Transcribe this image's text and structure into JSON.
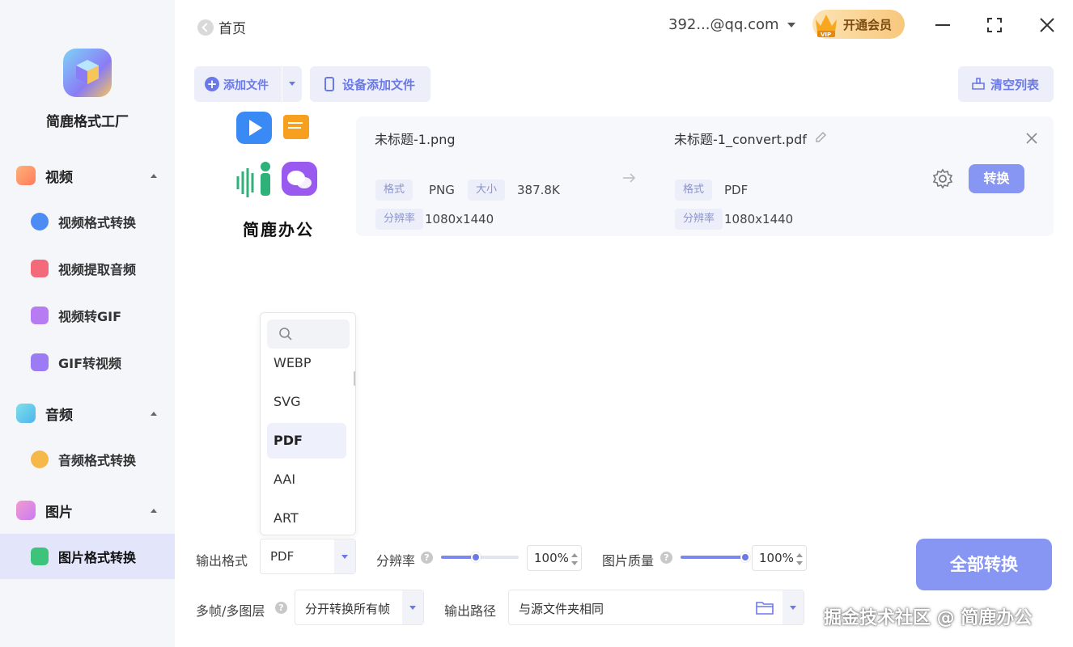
{
  "sidebar": {
    "app_name": "简鹿格式工厂",
    "groups": [
      {
        "label": "视频",
        "items": [
          "视频格式转换",
          "视频提取音频",
          "视频转GIF",
          "GIF转视频"
        ]
      },
      {
        "label": "音频",
        "items": [
          "音频格式转换"
        ]
      },
      {
        "label": "图片",
        "items": [
          "图片格式转换"
        ]
      }
    ],
    "active_item": "图片格式转换"
  },
  "topbar": {
    "back_label": "首页",
    "account": "392...@qq.com",
    "vip_label": "开通会员"
  },
  "toolbar": {
    "add_file": "添加文件",
    "device_add": "设备添加文件",
    "clear_list": "清空列表"
  },
  "promo": {
    "brand_text": "简鹿办公"
  },
  "file": {
    "source_name": "未标题-1.png",
    "target_name": "未标题-1_convert.pdf",
    "format_label": "格式",
    "size_label": "大小",
    "resolution_label": "分辨率",
    "source_format": "PNG",
    "source_size": "387.8K",
    "source_resolution": "1080x1440",
    "target_format": "PDF",
    "target_resolution": "1080x1440",
    "convert_label": "转换"
  },
  "dropdown": {
    "options": [
      "WEBP",
      "SVG",
      "PDF",
      "AAI",
      "ART"
    ],
    "selected": "PDF"
  },
  "settings": {
    "output_format_label": "输出格式",
    "output_format_value": "PDF",
    "resolution_label": "分辨率",
    "resolution_value": "100%",
    "resolution_level": 0.45,
    "quality_label": "图片质量",
    "quality_value": "100%",
    "quality_level": 1.0,
    "multiframe_label": "多帧/多图层",
    "multiframe_value": "分开转换所有帧",
    "output_path_label": "输出路径",
    "output_path_value": "与源文件夹相同",
    "convert_all": "全部转换"
  },
  "watermark": "掘金技术社区 @ 简鹿办公",
  "colors": {
    "accent": "#6b79e8",
    "button": "#8795f3",
    "active_nav": "#e3e6fb"
  }
}
